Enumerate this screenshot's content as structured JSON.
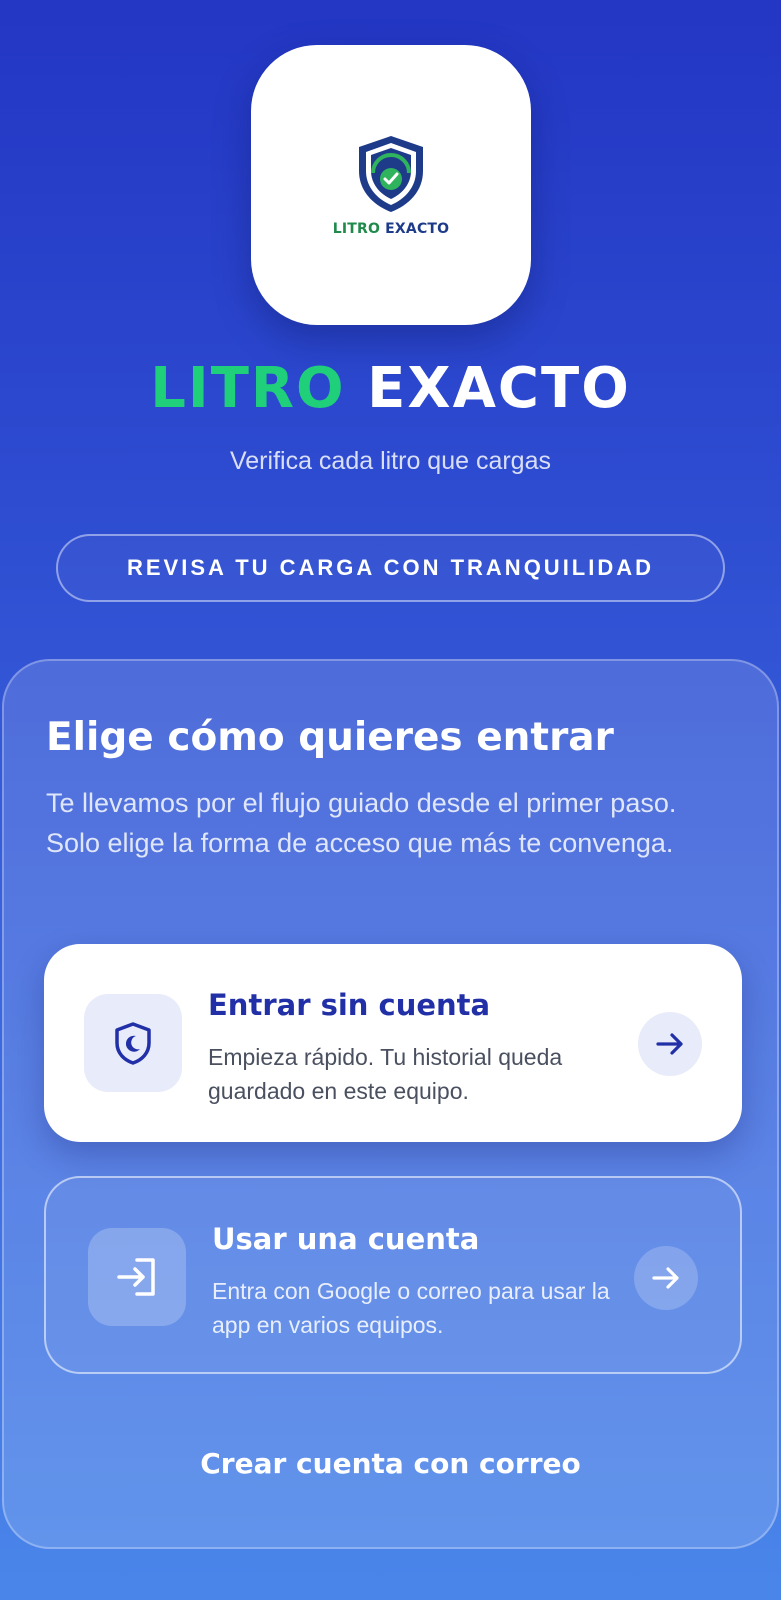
{
  "logo": {
    "text_green": "LITRO",
    "text_blue": "EXACTO"
  },
  "brand": {
    "title_green": "LITRO",
    "title_white": "EXACTO",
    "tagline": "Verifica cada litro que cargas"
  },
  "badge": {
    "label": "REVISA TU CARGA CON TRANQUILIDAD"
  },
  "access": {
    "title": "Elige cómo quieres entrar",
    "description": "Te llevamos por el flujo guiado desde el primer paso. Solo elige la forma de acceso que más te convenga.",
    "options": [
      {
        "title": "Entrar sin cuenta",
        "description": "Empieza rápido. Tu historial queda guardado en este equipo.",
        "icon": "shield-moon-icon"
      },
      {
        "title": "Usar una cuenta",
        "description": "Entra con Google o correo para usar la app en varios equipos.",
        "icon": "login-icon"
      }
    ],
    "create_account_label": "Crear cuenta con correo"
  },
  "colors": {
    "brand_green": "#1fcf7a",
    "primary_blue": "#2230a8",
    "background_top": "#2336c4",
    "background_bottom": "#4a86ea"
  }
}
